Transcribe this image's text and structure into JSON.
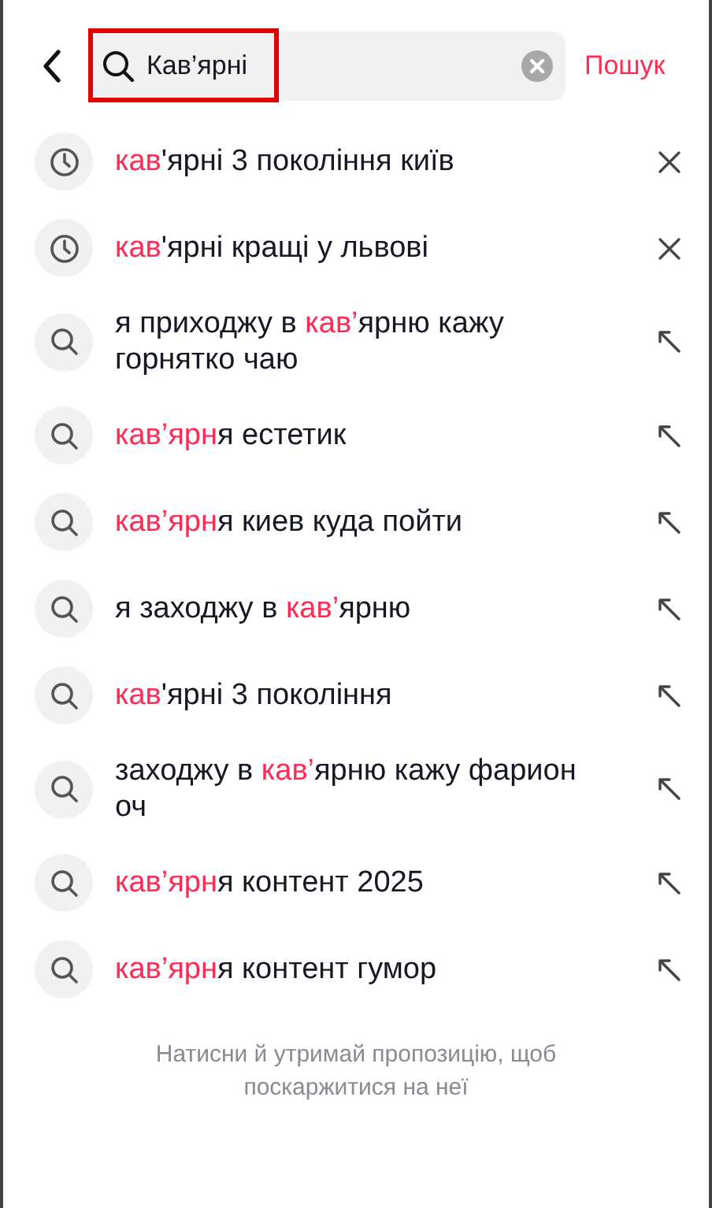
{
  "search": {
    "value": "Кав’ярні",
    "action": "Пошук"
  },
  "suggestions": [
    {
      "kind": "history",
      "parts": [
        {
          "text": "кав",
          "match": true
        },
        {
          "text": "'ярні 3 покоління київ",
          "match": false
        }
      ]
    },
    {
      "kind": "history",
      "parts": [
        {
          "text": "кав",
          "match": true
        },
        {
          "text": "'ярні кращі у львові",
          "match": false
        }
      ]
    },
    {
      "kind": "suggestion",
      "parts": [
        {
          "text": "я приходжу в ",
          "match": false
        },
        {
          "text": "кав’",
          "match": true
        },
        {
          "text": "ярню кажу горнятко чаю",
          "match": false
        }
      ]
    },
    {
      "kind": "suggestion",
      "parts": [
        {
          "text": "кав’ярн",
          "match": true
        },
        {
          "text": "я естетик",
          "match": false
        }
      ]
    },
    {
      "kind": "suggestion",
      "parts": [
        {
          "text": "кав’ярн",
          "match": true
        },
        {
          "text": "я киев куда пойти",
          "match": false
        }
      ]
    },
    {
      "kind": "suggestion",
      "parts": [
        {
          "text": "я заходжу в ",
          "match": false
        },
        {
          "text": "кав’",
          "match": true
        },
        {
          "text": "ярню",
          "match": false
        }
      ]
    },
    {
      "kind": "suggestion",
      "parts": [
        {
          "text": "кав",
          "match": true
        },
        {
          "text": "'ярні 3 покоління",
          "match": false
        }
      ]
    },
    {
      "kind": "suggestion",
      "parts": [
        {
          "text": "заходжу в ",
          "match": false
        },
        {
          "text": "кав’",
          "match": true
        },
        {
          "text": "ярню кажу фарион оч",
          "match": false
        }
      ]
    },
    {
      "kind": "suggestion",
      "parts": [
        {
          "text": "кав’ярн",
          "match": true
        },
        {
          "text": "я контент 2025",
          "match": false
        }
      ]
    },
    {
      "kind": "suggestion",
      "parts": [
        {
          "text": "кав’ярн",
          "match": true
        },
        {
          "text": "я контент гумор",
          "match": false
        }
      ]
    }
  ],
  "hint": "Натисни й утримай пропозицію, щоб поскаржитися на неї"
}
